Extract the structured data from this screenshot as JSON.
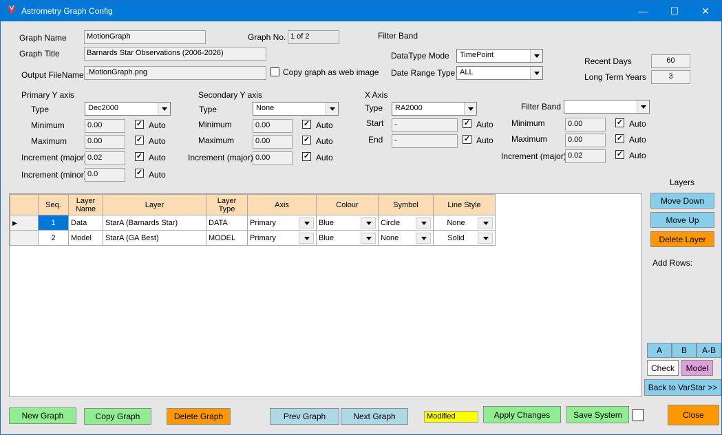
{
  "window": {
    "title": "Astrometry Graph Config",
    "minimize": "—",
    "maximize": "☐",
    "close": "✕"
  },
  "graph": {
    "name_label": "Graph Name",
    "name": "MotionGraph",
    "no_label": "Graph No.",
    "no": "1 of 2",
    "title_label": "Graph Title",
    "title": "Barnards Star Observations (2006-2026)",
    "output_label": "Output FileName",
    "output": ".MotionGraph.png",
    "copy_web_label": "Copy graph as web image",
    "filter_band_header": "Filter Band",
    "datatype_label": "DataType Mode",
    "datatype": "TimePoint",
    "daterange_label": "Date Range Type",
    "daterange": "ALL",
    "recent_label": "Recent Days",
    "recent": "60",
    "longterm_label": "Long Term Years",
    "longterm": "3"
  },
  "primary_y": {
    "header": "Primary Y axis",
    "type_label": "Type",
    "type": "Dec2000",
    "min_label": "Minimum",
    "min": "0.00",
    "max_label": "Maximum",
    "max": "0.00",
    "incmaj_label": "Increment (major)",
    "incmaj": "0.02",
    "incmin_label": "Increment (minor)",
    "incmin": "0.0",
    "auto": "Auto"
  },
  "secondary_y": {
    "header": "Secondary Y axis",
    "type_label": "Type",
    "type": "None",
    "min_label": "Minimum",
    "min": "0.00",
    "max_label": "Maximum",
    "max": "0.00",
    "incmaj_label": "Increment (major)",
    "incmaj": "0.00",
    "auto": "Auto"
  },
  "x_axis": {
    "header": "X Axis",
    "type_label": "Type",
    "type": "RA2000",
    "start_label": "Start",
    "start": "-",
    "end_label": "End",
    "end": "-",
    "auto": "Auto"
  },
  "filter": {
    "band_label": "Filter Band",
    "band": "",
    "min_label": "Minimum",
    "min": "0.00",
    "max_label": "Maximum",
    "max": "0.00",
    "incmaj_label": "Increment (major)",
    "incmaj": "0.02",
    "auto": "Auto"
  },
  "layers_table": {
    "headers": [
      "Seq.",
      "Layer\nName",
      "Layer",
      "Layer\nType",
      "Axis",
      "Colour",
      "Symbol",
      "Line Style"
    ],
    "rows": [
      {
        "seq": "1",
        "name": "Data",
        "layer": "StarA (Barnards Star)",
        "type": "DATA",
        "axis": "Primary",
        "colour": "Blue",
        "symbol": "Circle",
        "line": "None"
      },
      {
        "seq": "2",
        "name": "Model",
        "layer": "StarA (GA Best)",
        "type": "MODEL",
        "axis": "Primary",
        "colour": "Blue",
        "symbol": "None",
        "line": "Solid"
      }
    ]
  },
  "side": {
    "layers_label": "Layers",
    "move_down": "Move Down",
    "move_up": "Move Up",
    "delete_layer": "Delete Layer",
    "add_rows": "Add Rows:",
    "a": "A",
    "b": "B",
    "ab": "A-B",
    "check": "Check",
    "model": "Model",
    "back": "Back to VarStar >>"
  },
  "footer": {
    "new_graph": "New Graph",
    "copy_graph": "Copy Graph",
    "delete_graph": "Delete Graph",
    "prev_graph": "Prev Graph",
    "next_graph": "Next Graph",
    "status": "Modified",
    "apply": "Apply Changes",
    "save_system": "Save System",
    "close": "Close"
  },
  "colors": {
    "title_bar": "#0078d7",
    "green": "#90ee90",
    "orange": "#ff9800",
    "blue": "#add8e6",
    "header": "#fbdcb4",
    "status": "#ffff00"
  }
}
